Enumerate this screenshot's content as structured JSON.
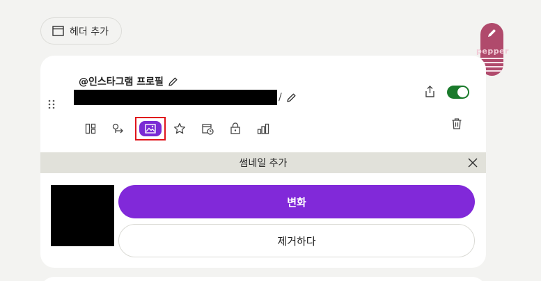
{
  "header": {
    "add_label": "헤더 추가"
  },
  "badge": {
    "text": "pepper",
    "color": "#b04a6c"
  },
  "link": {
    "title": "@인스타그램 프로필",
    "url_suffix": "/",
    "enabled": true
  },
  "toolbar": {
    "icons": [
      "layout-icon",
      "redirect-icon",
      "thumbnail-icon",
      "star-icon",
      "schedule-icon",
      "lock-icon",
      "analytics-icon"
    ],
    "active": "thumbnail-icon"
  },
  "thumbnail": {
    "panel_title": "썸네일 추가",
    "change_label": "변화",
    "remove_label": "제거하다"
  },
  "colors": {
    "accent": "#8129d9",
    "toggle_on": "#1a7a2b",
    "highlight_border": "#e0141b"
  }
}
